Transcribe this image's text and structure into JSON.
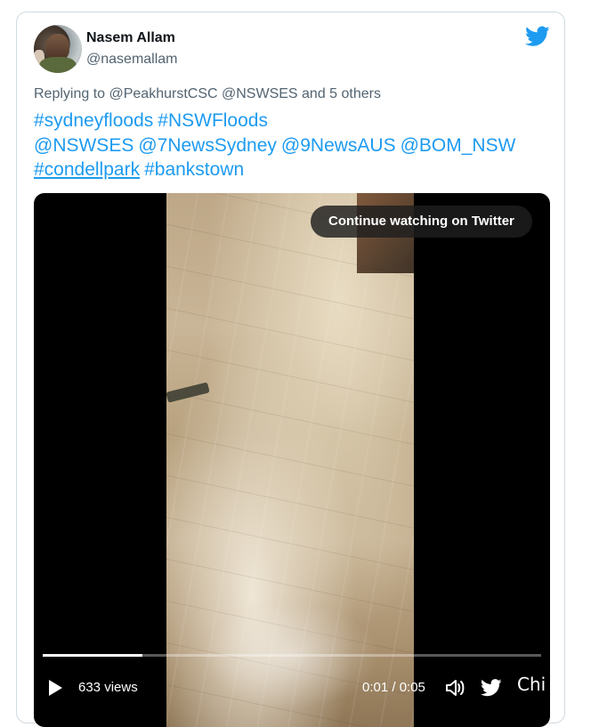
{
  "tweet": {
    "display_name": "Nasem Allam",
    "handle": "@nasemallam",
    "reply_line": "Replying to @PeakhurstCSC @NSWSES and 5 others",
    "line1": [
      "#sydneyfloods",
      "#NSWFloods"
    ],
    "line2": [
      "@NSWSES",
      "@7NewsSydney",
      "@9NewsAUS",
      "@BOM_NSW"
    ],
    "line3": [
      "#condellpark",
      "#bankstown"
    ]
  },
  "video": {
    "continue_label": "Continue watching on Twitter",
    "views": "633 views",
    "time": "0:01 / 0:05",
    "progress": 0.2,
    "extra_label": "Chi"
  },
  "colors": {
    "link": "#1d9bf0",
    "twitter_blue": "#1d9bf0",
    "muted": "#536471",
    "text": "#0f1419"
  },
  "icons": {
    "brand": "twitter-bird-icon",
    "play": "play-icon",
    "volume": "volume-icon"
  }
}
